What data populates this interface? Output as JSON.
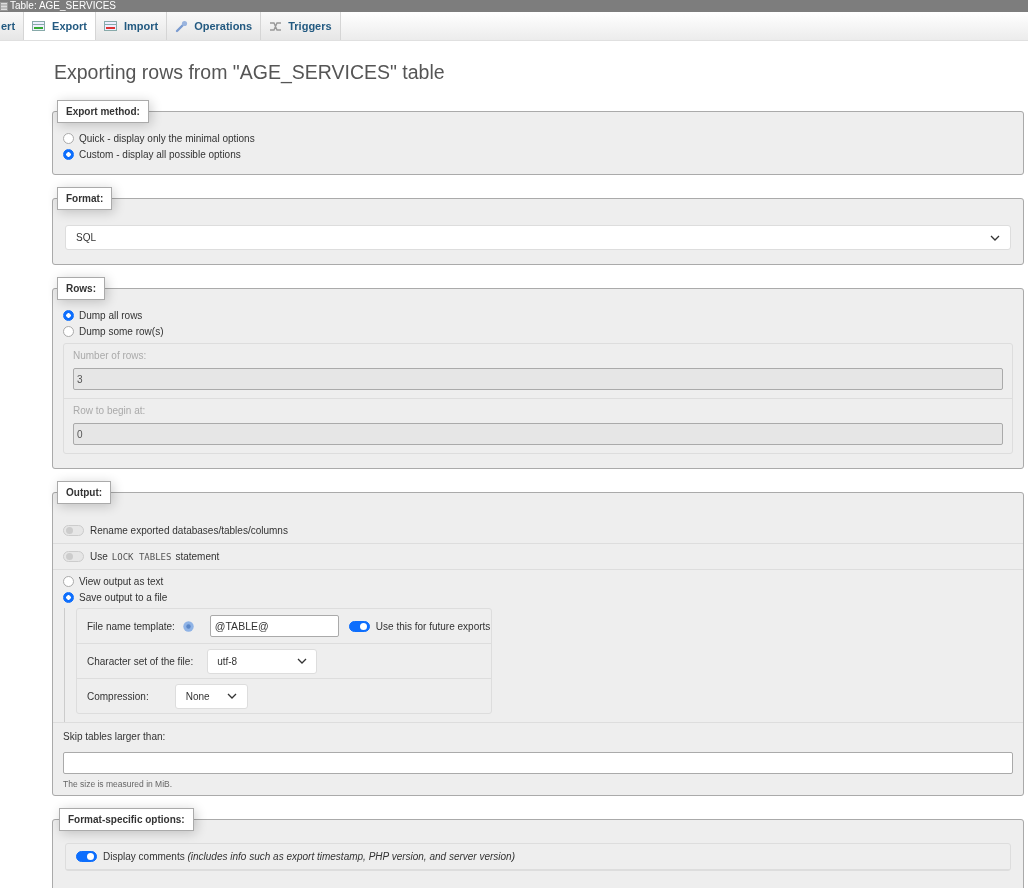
{
  "window": {
    "title": "Table: AGE_SERVICES"
  },
  "tabs": [
    {
      "label": "ert",
      "selected": false
    },
    {
      "label": "Export",
      "selected": true
    },
    {
      "label": "Import",
      "selected": false
    },
    {
      "label": "Operations",
      "selected": false
    },
    {
      "label": "Triggers",
      "selected": false
    }
  ],
  "heading": "Exporting rows from \"AGE_SERVICES\" table",
  "export_method": {
    "legend": "Export method:",
    "options": [
      {
        "label": "Quick - display only the minimal options",
        "selected": false
      },
      {
        "label": "Custom - display all possible options",
        "selected": true
      }
    ]
  },
  "format": {
    "legend": "Format:",
    "value": "SQL"
  },
  "rows": {
    "legend": "Rows:",
    "options": [
      {
        "label": "Dump all rows",
        "selected": true
      },
      {
        "label": "Dump some row(s)",
        "selected": false
      }
    ],
    "fields": [
      {
        "label": "Number of rows:",
        "value": "3",
        "disabled": true
      },
      {
        "label": "Row to begin at:",
        "value": "0",
        "disabled": true
      }
    ]
  },
  "output": {
    "legend": "Output:",
    "toggles": [
      {
        "parts": [
          {
            "text": "Rename exported databases/tables/columns",
            "kind": "plain"
          }
        ],
        "on": false
      },
      {
        "parts": [
          {
            "text": "Use",
            "kind": "plain"
          },
          {
            "text": "LOCK TABLES",
            "kind": "code"
          },
          {
            "text": "statement",
            "kind": "plain"
          }
        ],
        "on": false
      }
    ],
    "options": [
      {
        "label": "View output as text",
        "selected": false
      },
      {
        "label": "Save output to a file",
        "selected": true
      }
    ],
    "file": {
      "template_label": "File name template:",
      "template_value": "@TABLE@",
      "future": {
        "label": "Use this for future exports",
        "on": true
      },
      "charset_label": "Character set of the file:",
      "charset": "utf-8",
      "compression_label": "Compression:",
      "compression": "None"
    },
    "skip_label": "Skip tables larger than:",
    "skip_hint": "The size is measured in MiB."
  },
  "format_specific": {
    "legend": "Format-specific options:",
    "toggles": [
      {
        "label": "Display comments *(includes info such as export timestamp, PHP version, and server version)*",
        "on": true
      }
    ]
  }
}
